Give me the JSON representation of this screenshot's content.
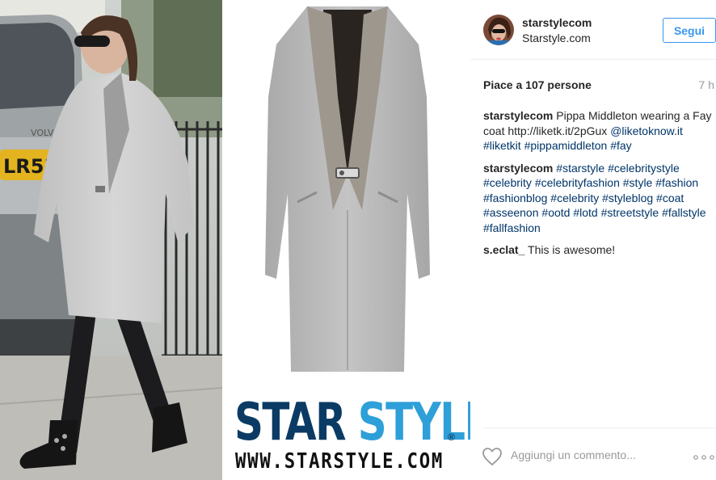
{
  "photo": {
    "plate_text": "LR53",
    "brand_text": "VOLV",
    "logo": {
      "word1": "STAR",
      "word2": "STYLE",
      "registered": "®",
      "url": "WWW.STARSTYLE.COM"
    }
  },
  "post": {
    "username": "starstylecom",
    "location": "Starstyle.com",
    "follow_label": "Segui",
    "likes": "Piace a 107 persone",
    "time": "7 h"
  },
  "comments": [
    {
      "user": "starstylecom",
      "parts": [
        {
          "text": " Pippa Middleton wearing a Fay coat http://liketk.it/2pGux ",
          "link": false
        },
        {
          "text": "@liketoknow.it",
          "link": true
        },
        {
          "text": " ",
          "link": false
        },
        {
          "text": "#liketkit",
          "link": true
        },
        {
          "text": " ",
          "link": false
        },
        {
          "text": "#pippamiddleton",
          "link": true
        },
        {
          "text": " ",
          "link": false
        },
        {
          "text": "#fay",
          "link": true
        }
      ]
    },
    {
      "user": "starstylecom",
      "parts": [
        {
          "text": " ",
          "link": false
        },
        {
          "text": "#starstyle",
          "link": true
        },
        {
          "text": " ",
          "link": false
        },
        {
          "text": "#celebritystyle",
          "link": true
        },
        {
          "text": " ",
          "link": false
        },
        {
          "text": "#celebrity",
          "link": true
        },
        {
          "text": " ",
          "link": false
        },
        {
          "text": "#celebrityfashion",
          "link": true
        },
        {
          "text": " ",
          "link": false
        },
        {
          "text": "#style",
          "link": true
        },
        {
          "text": " ",
          "link": false
        },
        {
          "text": "#fashion",
          "link": true
        },
        {
          "text": " ",
          "link": false
        },
        {
          "text": "#fashionblog",
          "link": true
        },
        {
          "text": " ",
          "link": false
        },
        {
          "text": "#celebrity",
          "link": true
        },
        {
          "text": " ",
          "link": false
        },
        {
          "text": "#styleblog",
          "link": true
        },
        {
          "text": " ",
          "link": false
        },
        {
          "text": "#coat",
          "link": true
        },
        {
          "text": " ",
          "link": false
        },
        {
          "text": "#asseenon",
          "link": true
        },
        {
          "text": " ",
          "link": false
        },
        {
          "text": "#ootd",
          "link": true
        },
        {
          "text": " ",
          "link": false
        },
        {
          "text": "#lotd",
          "link": true
        },
        {
          "text": " ",
          "link": false
        },
        {
          "text": "#streetstyle",
          "link": true
        },
        {
          "text": " ",
          "link": false
        },
        {
          "text": "#fallstyle",
          "link": true
        },
        {
          "text": " ",
          "link": false
        },
        {
          "text": "#fallfashion",
          "link": true
        }
      ]
    },
    {
      "user": "s.eclat_",
      "parts": [
        {
          "text": " This is awesome!",
          "link": false
        }
      ]
    }
  ],
  "footer": {
    "comment_placeholder": "Aggiungi un commento...",
    "like_icon": "heart-icon",
    "more_icon": "more-options-icon"
  },
  "colors": {
    "accent": "#3897f0",
    "link": "#003569",
    "muted": "#999999",
    "text": "#262626"
  }
}
